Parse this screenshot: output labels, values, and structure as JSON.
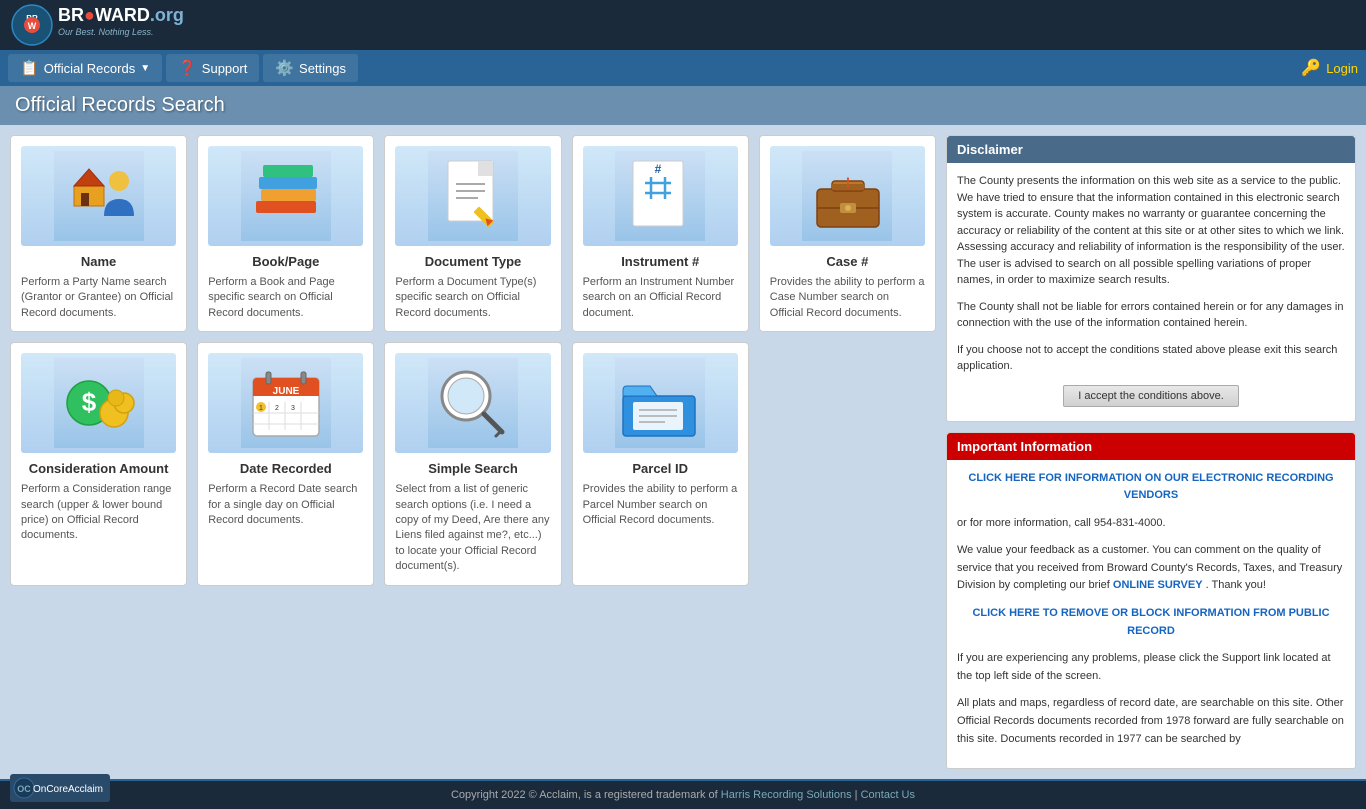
{
  "header": {
    "logo_top": "BR🔴WARD.org",
    "logo_sub": "Our Best. Nothing Less.",
    "site_title": "BROWARD.org"
  },
  "navbar": {
    "items": [
      {
        "id": "official-records",
        "label": "Official Records",
        "icon": "📋",
        "has_dropdown": true
      },
      {
        "id": "support",
        "label": "Support",
        "icon": "❓"
      },
      {
        "id": "settings",
        "label": "Settings",
        "icon": "⚙️"
      }
    ],
    "login": {
      "label": "Login",
      "icon": "🔑"
    }
  },
  "page_title": "Official Records Search",
  "search_cards": [
    {
      "id": "name",
      "title": "Name",
      "icon": "house",
      "description": "Perform a Party Name search (Grantor or Grantee) on Official Record documents."
    },
    {
      "id": "book-page",
      "title": "Book/Page",
      "icon": "book",
      "description": "Perform a Book and Page specific search on Official Record documents."
    },
    {
      "id": "document-type",
      "title": "Document Type",
      "icon": "doc",
      "description": "Perform a Document Type(s) specific search on Official Record documents."
    },
    {
      "id": "instrument",
      "title": "Instrument #",
      "icon": "hash",
      "description": "Perform an Instrument Number search on an Official Record document."
    },
    {
      "id": "case",
      "title": "Case #",
      "icon": "case",
      "description": "Provides the ability to perform a Case Number search on Official Record documents."
    },
    {
      "id": "consideration",
      "title": "Consideration Amount",
      "icon": "money",
      "description": "Perform a Consideration range search (upper & lower bound price) on Official Record documents."
    },
    {
      "id": "date-recorded",
      "title": "Date Recorded",
      "icon": "calendar",
      "description": "Perform a Record Date search for a single day on Official Record documents."
    },
    {
      "id": "simple-search",
      "title": "Simple Search",
      "icon": "search",
      "description": "Select from a list of generic search options (i.e. I need a copy of my Deed, Are there any Liens filed against me?, etc...) to locate your Official Record document(s)."
    },
    {
      "id": "parcel-id",
      "title": "Parcel ID",
      "icon": "folder",
      "description": "Provides the ability to perform a Parcel Number search on Official Record documents."
    }
  ],
  "disclaimer": {
    "title": "Disclaimer",
    "paragraphs": [
      "The County presents the information on this web site as a service to the public. We have tried to ensure that the information contained in this electronic search system is accurate. County makes no warranty or guarantee concerning the accuracy or reliability of the content at this site or at other sites to which we link. Assessing accuracy and reliability of information is the responsibility of the user. The user is advised to search on all possible spelling variations of proper names, in order to maximize search results.",
      "The County shall not be liable for errors contained herein or for any damages in connection with the use of the information contained herein.",
      "If you choose not to accept the conditions stated above please exit this search application."
    ],
    "accept_button": "I accept the conditions above."
  },
  "important_info": {
    "title": "Important Information",
    "link1_text": "CLICK HERE FOR INFORMATION ON OUR ELECTRONIC RECORDING VENDORS",
    "link1_suffix": " or for more information, call 954-831-4000.",
    "feedback_text": "We value your feedback as a customer. You can comment on the quality of service that you received from Broward County's Records, Taxes, and Treasury Division by completing our brief ",
    "survey_link_text": "ONLINE SURVEY",
    "feedback_suffix": ". Thank you!",
    "link2_text": "CLICK HERE TO REMOVE OR BLOCK INFORMATION FROM PUBLIC RECORD",
    "support_text": "If you are experiencing any problems, please click the Support link located at the top left side of the screen.",
    "records_text": "All plats and maps, regardless of record date, are searchable on this site. Other Official Records documents recorded from 1978 forward are fully searchable on this site. Documents recorded in 1977 can be searched by"
  },
  "footer": {
    "logo_text": "OnCoreAcclaim",
    "copyright": "Copyright 2022 © Acclaim, is a registered trademark of ",
    "company_link": "Harris Recording Solutions",
    "separator": " | ",
    "contact_link": "Contact Us"
  }
}
